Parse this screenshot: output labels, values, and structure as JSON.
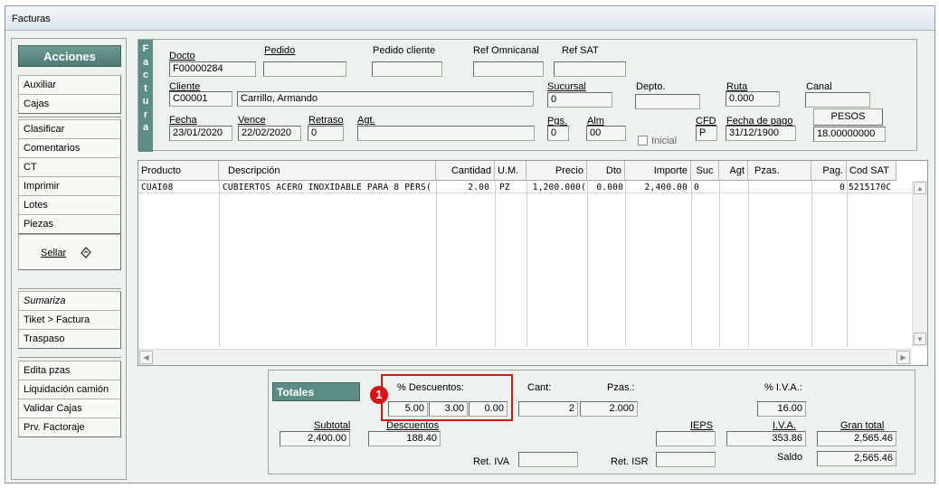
{
  "window": {
    "title": "Facturas"
  },
  "acciones": {
    "header": "Acciones",
    "group1": [
      "Auxiliar",
      "Cajas"
    ],
    "group2": [
      "Clasificar",
      "Comentarios",
      "CT",
      "Imprimir",
      "Lotes",
      "Piezas"
    ],
    "sellar": "Sellar",
    "group3": [
      "Sumariza",
      "Tiket > Factura",
      "Traspaso"
    ],
    "group4": [
      "Edita pzas",
      "Liquidación camión",
      "Validar Cajas",
      "Prv. Factoraje"
    ]
  },
  "factura": {
    "side_label": [
      "F",
      "a",
      "c",
      "t",
      "u",
      "r",
      "a"
    ],
    "docto_label": "Docto",
    "docto": "F00000284",
    "pedido_label": "Pedido",
    "pedido": "",
    "pedido_cliente_label": "Pedido cliente",
    "pedido_cliente": "",
    "ref_omnicanal_label": "Ref Omnicanal",
    "ref_omnicanal": "",
    "ref_sat_label": "Ref SAT",
    "ref_sat": "",
    "cliente_label": "Cliente",
    "cliente_code": "C00001",
    "cliente_name": "Carrillo, Armando",
    "sucursal_label": "Sucursal",
    "sucursal": "0",
    "depto_label": "Depto.",
    "depto": "",
    "ruta_label": "Ruta",
    "ruta": "0.000",
    "canal_label": "Canal",
    "canal": "",
    "fecha_label": "Fecha",
    "fecha": "23/01/2020",
    "vence_label": "Vence",
    "vence": "22/02/2020",
    "retraso_label": "Retraso",
    "retraso": "0",
    "agt_label": "Agt.",
    "agt": "",
    "pgs_label": "Pgs.",
    "pgs": "0",
    "alm_label": "Alm",
    "alm": "00",
    "inicial_label": "Inicial",
    "cfd_label": "CFD",
    "cfd": "P",
    "fecha_pago_label": "Fecha de pago",
    "fecha_pago": "31/12/1900",
    "moneda_button": "PESOS",
    "tipo_cambio": "18.00000000"
  },
  "grid": {
    "headers": [
      "Producto",
      "Descripción",
      "Cantidad",
      "U.M.",
      "Precio",
      "Dto",
      "Importe",
      "Suc",
      "Agt",
      "Pzas.",
      "Pag.",
      "Cod SAT"
    ],
    "rows": [
      {
        "producto": "CUAI08",
        "descripcion": "CUBIERTOS ACERO INOXIDABLE PARA 8 PERS(",
        "cantidad": "2.00",
        "um": "PZ",
        "precio": "1,200.000(",
        "dto": "0.000",
        "importe": "2,400.00",
        "suc": "0",
        "agt": "",
        "pzas": "",
        "pag": "0",
        "cod_sat": "5215170C"
      }
    ]
  },
  "totales": {
    "header": "Totales",
    "descuentos_label": "% Descuentos:",
    "descuentos": [
      "5.00",
      "3.00",
      "0.00"
    ],
    "cant_label": "Cant:",
    "cant": "2",
    "pzas_label": "Pzas.:",
    "pzas": "2.000",
    "iva_pct_label": "% I.V.A.:",
    "iva_pct": "16.00",
    "subtotal_label": "Subtotal",
    "subtotal": "2,400.00",
    "descuentos_total_label": "Descuentos",
    "descuentos_total": "188.40",
    "ieps_label": "IEPS",
    "ieps": "",
    "iva_label": "I.V.A.",
    "iva": "353.86",
    "gran_total_label": "Gran total",
    "gran_total": "2,565.46",
    "saldo_label": "Saldo",
    "saldo": "2,565.46",
    "ret_iva_label": "Ret. IVA",
    "ret_iva": "",
    "ret_isr_label": "Ret. ISR",
    "ret_isr": "",
    "marker": "1"
  },
  "colors": {
    "accent": "#5d8b85",
    "highlight": "#d8141b"
  }
}
